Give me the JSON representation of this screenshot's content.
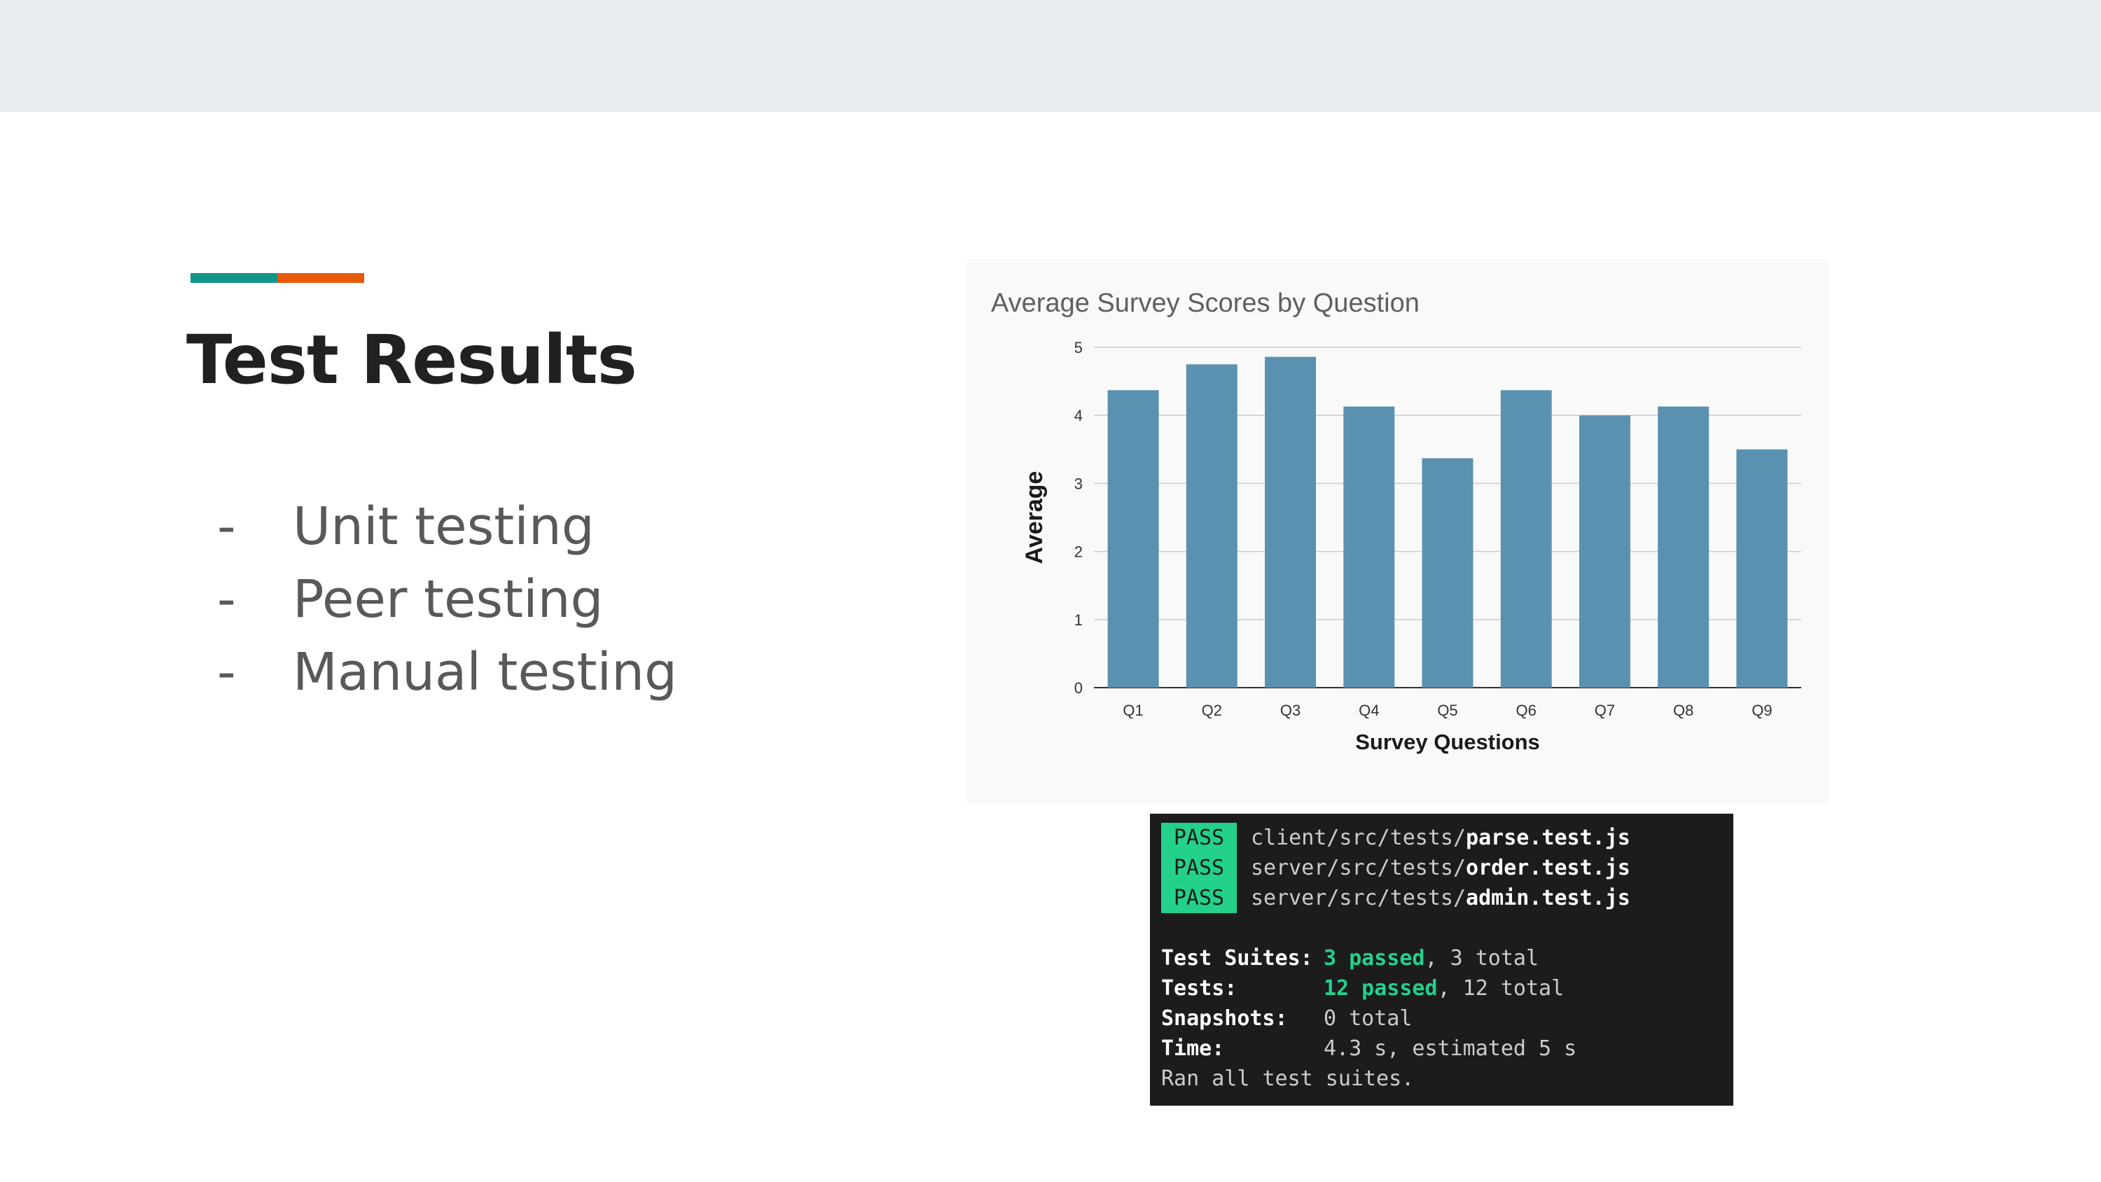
{
  "slide": {
    "title": "Test Results",
    "accent_colors": [
      "#13968a",
      "#e8590c"
    ],
    "bullets": [
      {
        "dash": "-",
        "text": "Unit testing"
      },
      {
        "dash": "-",
        "text": "Peer testing"
      },
      {
        "dash": "-",
        "text": "Manual testing"
      }
    ]
  },
  "chart_data": {
    "type": "bar",
    "title": "Average Survey Scores by Question",
    "xlabel": "Survey Questions",
    "ylabel": "Average",
    "categories": [
      "Q1",
      "Q2",
      "Q3",
      "Q4",
      "Q5",
      "Q6",
      "Q7",
      "Q8",
      "Q9"
    ],
    "values": [
      4.37,
      4.75,
      4.86,
      4.13,
      3.37,
      4.37,
      4.0,
      4.13,
      3.5
    ],
    "ylim": [
      0,
      5
    ],
    "yticks": [
      0,
      1,
      2,
      3,
      4,
      5
    ],
    "bar_color": "#5a91b0",
    "grid": true,
    "legend": "none"
  },
  "terminal": {
    "pass_label": "PASS",
    "results": [
      {
        "dir": "client/src/tests/",
        "file": "parse.test.js"
      },
      {
        "dir": "server/src/tests/",
        "file": "order.test.js"
      },
      {
        "dir": "server/src/tests/",
        "file": "admin.test.js"
      }
    ],
    "suites_label": "Test Suites:",
    "suites_passed": "3 passed",
    "suites_total": ", 3 total",
    "tests_label": "Tests:",
    "tests_passed": "12 passed",
    "tests_total": ", 12 total",
    "snapshots_label": "Snapshots:",
    "snapshots_value": "0 total",
    "time_label": "Time:",
    "time_value": "4.3 s, estimated 5 s",
    "footer": "Ran all test suites."
  }
}
